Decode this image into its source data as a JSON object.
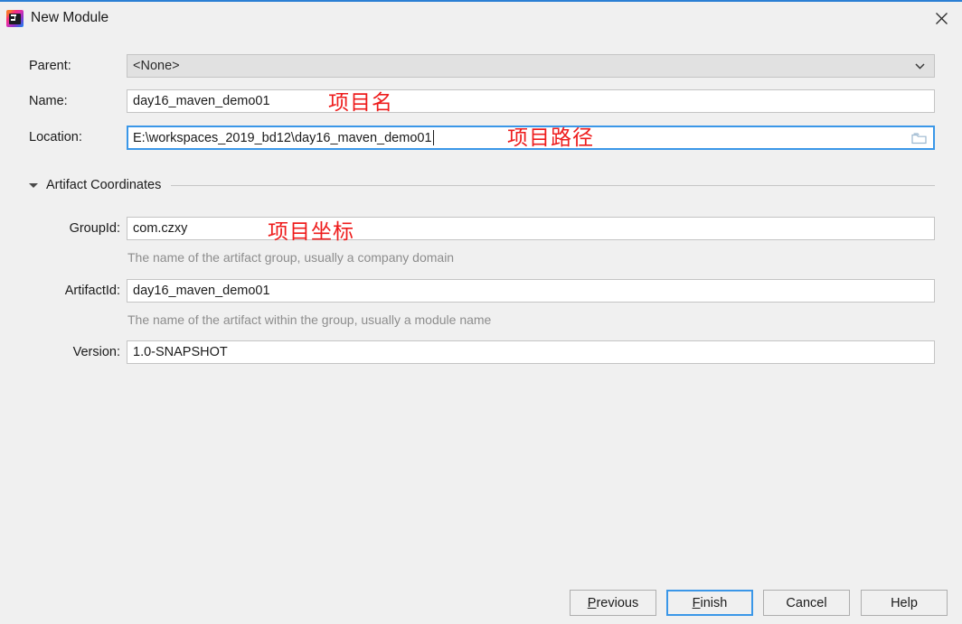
{
  "window": {
    "title": "New Module",
    "icon": "intellij-idea-icon",
    "close_icon": "close-icon",
    "accent_color": "#2b7fd4",
    "background_color": "#f0f0f0"
  },
  "form": {
    "parent": {
      "label": "Parent:",
      "value": "<None>",
      "enabled": false,
      "dropdown_icon": "chevron-down-icon"
    },
    "name": {
      "label": "Name:",
      "value": "day16_maven_demo01",
      "placeholder": ""
    },
    "location": {
      "label": "Location:",
      "value": "E:\\workspaces_2019_bd12\\day16_maven_demo01",
      "placeholder": "",
      "focused": true,
      "browse_icon": "folder-icon"
    }
  },
  "artifact_section": {
    "title": "Artifact Coordinates",
    "expanded": true,
    "toggle_icon": "triangle-down-icon",
    "group_id": {
      "label": "GroupId:",
      "value": "com.czxy",
      "hint": "The name of the artifact group, usually a company domain"
    },
    "artifact_id": {
      "label": "ArtifactId:",
      "value": "day16_maven_demo01",
      "hint": "The name of the artifact within the group, usually a module name"
    },
    "version": {
      "label": "Version:",
      "value": "1.0-SNAPSHOT",
      "hint": ""
    }
  },
  "annotations": {
    "color": "#ee1c1c",
    "items": [
      {
        "text": "项目名",
        "meaning": "project-name"
      },
      {
        "text": "项目路径",
        "meaning": "project-path"
      },
      {
        "text": "项目坐标",
        "meaning": "project-coordinates"
      }
    ]
  },
  "buttons": {
    "previous": {
      "prefix": "",
      "mnemonic": "P",
      "suffix": "revious"
    },
    "finish": {
      "prefix": "",
      "mnemonic": "F",
      "suffix": "inish",
      "is_default": true
    },
    "cancel": {
      "label": "Cancel"
    },
    "help": {
      "label": "Help"
    }
  }
}
